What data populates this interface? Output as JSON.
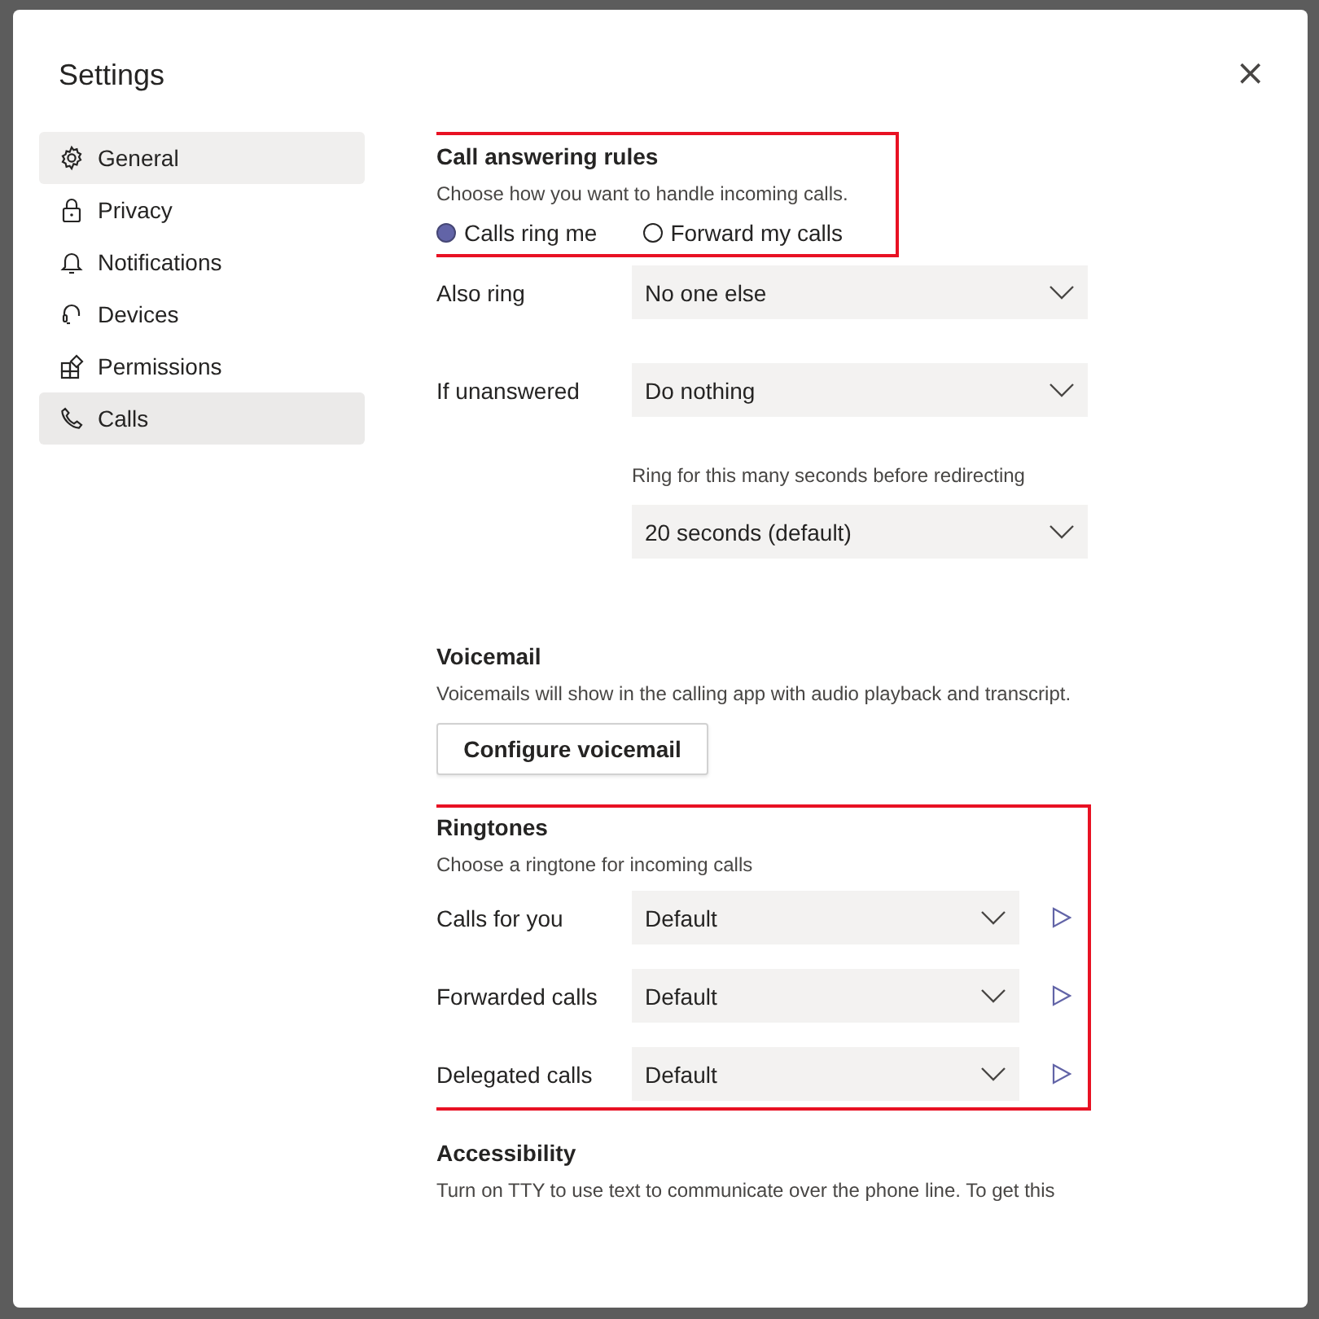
{
  "dialog": {
    "title": "Settings",
    "close": "×"
  },
  "sidebar": {
    "items": [
      {
        "label": "General",
        "selected": false,
        "hovered": true
      },
      {
        "label": "Privacy",
        "selected": false,
        "hovered": false
      },
      {
        "label": "Notifications",
        "selected": false,
        "hovered": false
      },
      {
        "label": "Devices",
        "selected": false,
        "hovered": false
      },
      {
        "label": "Permissions",
        "selected": false,
        "hovered": false
      },
      {
        "label": "Calls",
        "selected": true,
        "hovered": false
      }
    ]
  },
  "call_answering": {
    "title": "Call answering rules",
    "description": "Choose how you want to handle incoming calls.",
    "options": [
      {
        "label": "Calls ring me",
        "selected": true
      },
      {
        "label": "Forward my calls",
        "selected": false
      }
    ],
    "also_ring": {
      "label": "Also ring",
      "value": "No one else"
    },
    "if_unanswered": {
      "label": "If unanswered",
      "value": "Do nothing"
    },
    "ring_for": {
      "label": "Ring for this many seconds before redirecting",
      "value": "20 seconds (default)"
    }
  },
  "voicemail": {
    "title": "Voicemail",
    "description": "Voicemails will show in the calling app with audio playback and transcript.",
    "button": "Configure voicemail"
  },
  "ringtones": {
    "title": "Ringtones",
    "description": "Choose a ringtone for incoming calls",
    "rows": [
      {
        "label": "Calls for you",
        "value": "Default"
      },
      {
        "label": "Forwarded calls",
        "value": "Default"
      },
      {
        "label": "Delegated calls",
        "value": "Default"
      }
    ]
  },
  "accessibility": {
    "title": "Accessibility",
    "description": "Turn on TTY to use text to communicate over the phone line. To get this"
  }
}
